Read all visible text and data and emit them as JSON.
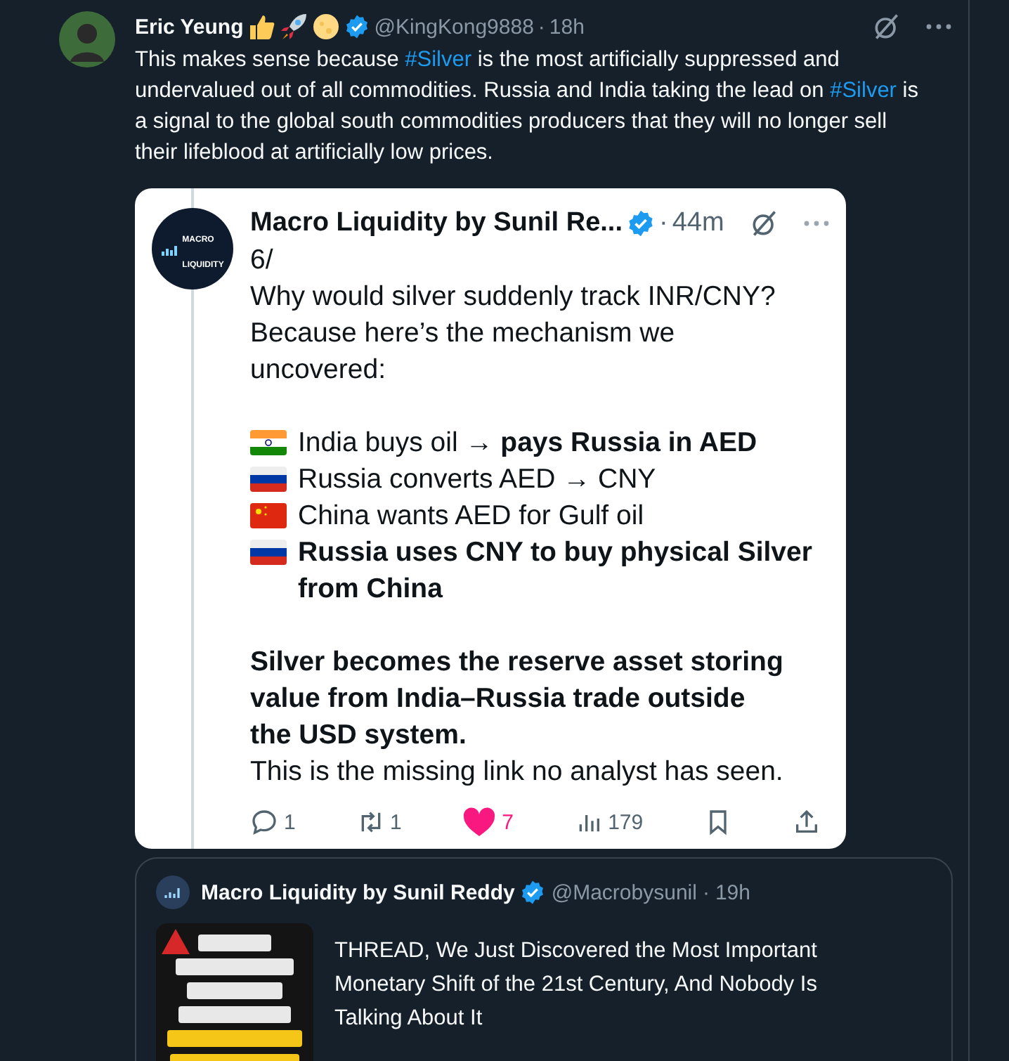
{
  "tweet": {
    "author": "Eric Yeung",
    "emojis": [
      {
        "kind": "thumbs-up"
      },
      {
        "kind": "rocket"
      },
      {
        "kind": "moon"
      }
    ],
    "verified": true,
    "handle": "@KingKong9888",
    "separator": "·",
    "time": "18h",
    "body": [
      {
        "kind": "text",
        "text": "This makes sense because "
      },
      {
        "kind": "hashtag",
        "text": "#Silver"
      },
      {
        "kind": "text",
        "text": " is the most artificially suppressed and undervalued out of all commodities. Russia and India taking the lead on "
      },
      {
        "kind": "hashtag",
        "text": "#Silver"
      },
      {
        "kind": "text",
        "text": " is a signal to the global south commodities producers that they will no longer sell their lifeblood at artificially low prices."
      }
    ]
  },
  "screenshot": {
    "logo": [
      "MACRO",
      "LIQUIDITY"
    ],
    "author": "Macro Liquidity by Sunil Re...",
    "verified": true,
    "separator": "·",
    "time": "44m",
    "blocks": [
      {
        "kind": "para",
        "text": "6/"
      },
      {
        "kind": "para",
        "text": "Why would silver suddenly track INR/CNY? Because here’s the mechanism we uncovered:"
      },
      {
        "kind": "gap"
      },
      {
        "kind": "india-flag",
        "text": "India buys oil → **pays Russia in AED**",
        "bold": false
      },
      {
        "kind": "russia-flag",
        "text": "Russia converts AED → CNY",
        "bold": false
      },
      {
        "kind": "china-flag",
        "text": "China wants AED for Gulf oil",
        "bold": false
      },
      {
        "kind": "russia-flag",
        "text": "Russia uses CNY to buy physical Silver from China",
        "bold": true
      },
      {
        "kind": "gap"
      },
      {
        "kind": "para",
        "text": "Silver becomes the reserve asset storing value from India–Russia trade outside the USD system.",
        "bold": true
      },
      {
        "kind": "para",
        "text": "This is the missing link no analyst has seen."
      }
    ],
    "actions": [
      {
        "kind": "reply",
        "count": "1"
      },
      {
        "kind": "retweet",
        "count": "1"
      },
      {
        "kind": "like",
        "count": "7",
        "selected": true
      },
      {
        "kind": "views",
        "count": "179"
      },
      {
        "kind": "bookmark"
      },
      {
        "kind": "share"
      }
    ]
  },
  "quote": {
    "author": "Macro Liquidity by Sunil Reddy",
    "verified": true,
    "handle": "@Macrobysunil",
    "separator": "·",
    "time": "19h",
    "text": "THREAD, We Just Discovered the Most Important Monetary Shift of the 21st Century, And Nobody Is Talking About It"
  }
}
